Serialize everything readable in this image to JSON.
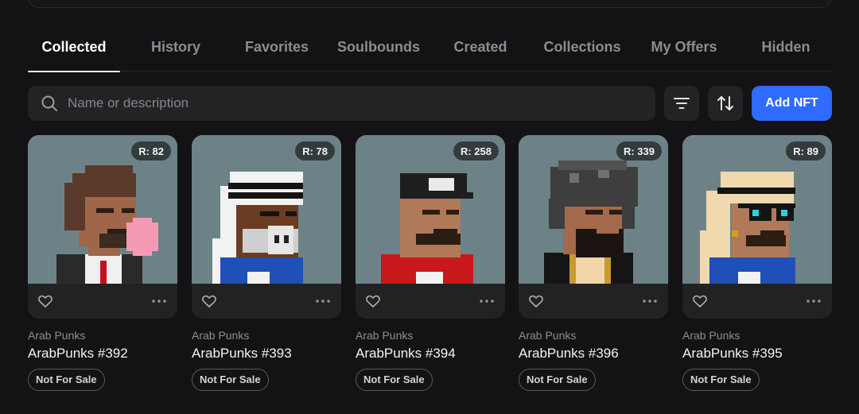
{
  "tabs": [
    {
      "label": "Collected",
      "active": true
    },
    {
      "label": "History"
    },
    {
      "label": "Favorites"
    },
    {
      "label": "Soulbounds"
    },
    {
      "label": "Created"
    },
    {
      "label": "Collections"
    },
    {
      "label": "My Offers"
    },
    {
      "label": "Hidden"
    }
  ],
  "toolbar": {
    "search_placeholder": "Name or description",
    "search_icon": "search-icon",
    "filter_icon": "filter-icon",
    "sort_icon": "sort-icon",
    "add_label": "Add NFT",
    "accent": "#2f6bff"
  },
  "cards": [
    {
      "rank": "R: 82",
      "collection": "Arab Punks",
      "name": "ArabPunks #392",
      "status": "Not For Sale"
    },
    {
      "rank": "R: 78",
      "collection": "Arab Punks",
      "name": "ArabPunks #393",
      "status": "Not For Sale"
    },
    {
      "rank": "R: 258",
      "collection": "Arab Punks",
      "name": "ArabPunks #394",
      "status": "Not For Sale"
    },
    {
      "rank": "R: 339",
      "collection": "Arab Punks",
      "name": "ArabPunks #396",
      "status": "Not For Sale"
    },
    {
      "rank": "R: 89",
      "collection": "Arab Punks",
      "name": "ArabPunks #395",
      "status": "Not For Sale"
    }
  ],
  "colors": {
    "background": "#131315",
    "card": "#222225",
    "art_background": "#6d8287"
  }
}
